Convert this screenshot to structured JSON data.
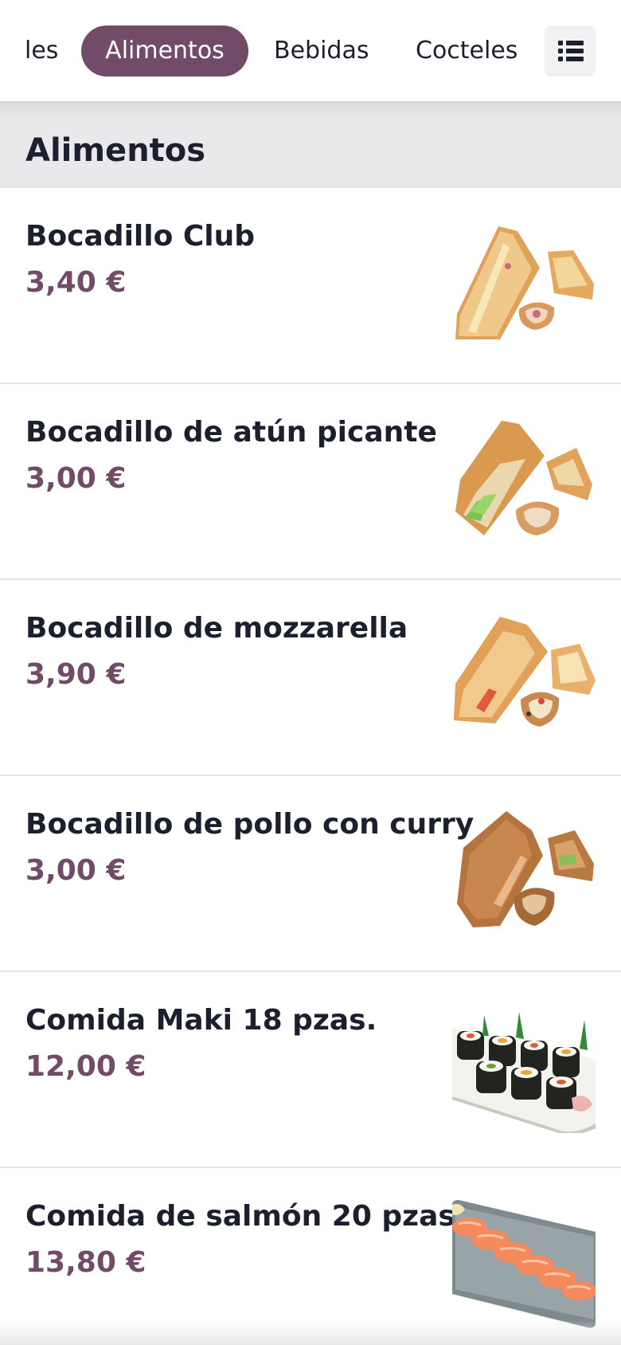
{
  "categories": {
    "previous": "les",
    "active": "Alimentos",
    "next_1": "Bebidas",
    "next_2": "Cocteles"
  },
  "section": {
    "title": "Alimentos"
  },
  "products": [
    {
      "name": "Bocadillo Club",
      "price": "3,40 €",
      "icon": "sandwich-image"
    },
    {
      "name": "Bocadillo de atún picante",
      "price": "3,00 €",
      "icon": "sandwich-image"
    },
    {
      "name": "Bocadillo de mozzarella",
      "price": "3,90 €",
      "icon": "sandwich-image"
    },
    {
      "name": "Bocadillo de pollo con curry",
      "price": "3,00 €",
      "icon": "sandwich-image"
    },
    {
      "name": "Comida Maki 18 pzas.",
      "price": "12,00 €",
      "icon": "maki-image"
    },
    {
      "name": "Comida de salmón 20 pzas.",
      "price": "13,80 €",
      "icon": "salmon-sushi-image"
    }
  ],
  "colors": {
    "accent": "#714b67",
    "text": "#1c1f2e",
    "section_bg": "#ebe8ec"
  }
}
